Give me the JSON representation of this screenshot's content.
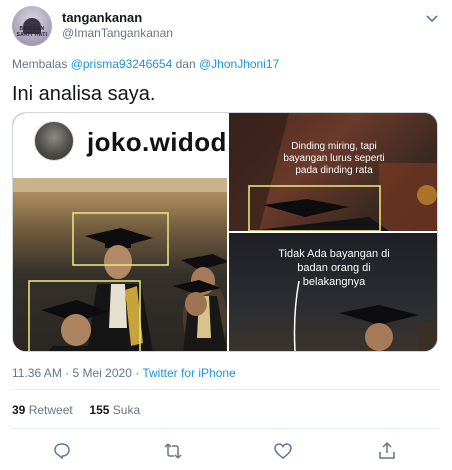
{
  "author": {
    "display_name": "tangankanan",
    "handle": "@ImanTangankanan",
    "avatar_text": "BARISAN SAKIT HATI"
  },
  "reply": {
    "prefix": "Membalas",
    "mention_1": "@prisma93246654",
    "conjunction": "dan",
    "mention_2": "@JhonJhoni17"
  },
  "tweet_text": "Ini analisa saya.",
  "media": {
    "left_username": "joko.widodo_",
    "annotation_top": [
      "Dinding miring, tapi",
      "bayangan lurus seperti",
      "pada dinding rata"
    ],
    "annotation_bottom": [
      "Tidak Ada bayangan di",
      "badan orang di",
      "belakangnya"
    ]
  },
  "meta": {
    "time": "11.36 AM",
    "date": "5 Mei 2020",
    "separator": "·",
    "source": "Twitter for iPhone"
  },
  "stats": {
    "retweet_count": "39",
    "retweet_label": "Retweet",
    "like_count": "155",
    "like_label": "Suka"
  },
  "actions": [
    "reply-icon",
    "retweet-icon",
    "like-icon",
    "share-icon"
  ],
  "colors": {
    "link": "#1b95e0",
    "secondary_text": "#657786",
    "annotation_box": "#e6e07a"
  }
}
